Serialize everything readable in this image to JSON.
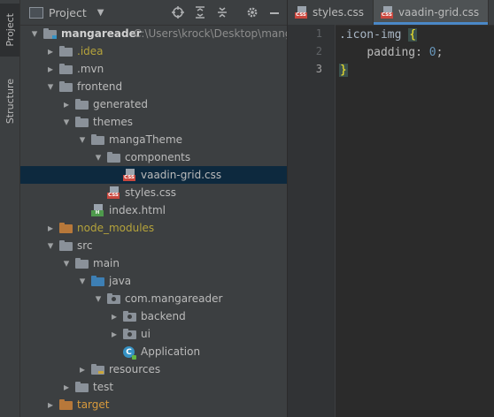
{
  "sidebar_tabs": {
    "project": "Project",
    "structure": "Structure"
  },
  "panel": {
    "title": "Project"
  },
  "tree": [
    {
      "label": "mangareader",
      "path": "C:\\Users\\krock\\Desktop\\mangare",
      "depth": 0,
      "arrow": "open",
      "icon": "folder-module",
      "style": "bold"
    },
    {
      "label": ".idea",
      "depth": 1,
      "arrow": "closed",
      "icon": "folder",
      "style": "yellow"
    },
    {
      "label": ".mvn",
      "depth": 1,
      "arrow": "closed",
      "icon": "folder"
    },
    {
      "label": "frontend",
      "depth": 1,
      "arrow": "open",
      "icon": "folder"
    },
    {
      "label": "generated",
      "depth": 2,
      "arrow": "closed",
      "icon": "folder"
    },
    {
      "label": "themes",
      "depth": 2,
      "arrow": "open",
      "icon": "folder"
    },
    {
      "label": "mangaTheme",
      "depth": 3,
      "arrow": "open",
      "icon": "folder"
    },
    {
      "label": "components",
      "depth": 4,
      "arrow": "open",
      "icon": "folder"
    },
    {
      "label": "vaadin-grid.css",
      "depth": 5,
      "arrow": "none",
      "icon": "css",
      "selected": true
    },
    {
      "label": "styles.css",
      "depth": 4,
      "arrow": "none",
      "icon": "css"
    },
    {
      "label": "index.html",
      "depth": 3,
      "arrow": "none",
      "icon": "html"
    },
    {
      "label": "node_modules",
      "depth": 1,
      "arrow": "closed",
      "icon": "folder-orange",
      "style": "yellow"
    },
    {
      "label": "src",
      "depth": 1,
      "arrow": "open",
      "icon": "folder"
    },
    {
      "label": "main",
      "depth": 2,
      "arrow": "open",
      "icon": "folder"
    },
    {
      "label": "java",
      "depth": 3,
      "arrow": "open",
      "icon": "folder-blue"
    },
    {
      "label": "com.mangareader",
      "depth": 4,
      "arrow": "open",
      "icon": "package"
    },
    {
      "label": "backend",
      "depth": 5,
      "arrow": "closed",
      "icon": "package"
    },
    {
      "label": "ui",
      "depth": 5,
      "arrow": "closed",
      "icon": "package"
    },
    {
      "label": "Application",
      "depth": 5,
      "arrow": "none",
      "icon": "app-class"
    },
    {
      "label": "resources",
      "depth": 3,
      "arrow": "closed",
      "icon": "folder-resources"
    },
    {
      "label": "test",
      "depth": 2,
      "arrow": "closed",
      "icon": "folder"
    },
    {
      "label": "target",
      "depth": 1,
      "arrow": "closed",
      "icon": "folder-orange",
      "style": "orange"
    }
  ],
  "editor_tabs": [
    {
      "label": "styles.css",
      "active": false
    },
    {
      "label": "vaadin-grid.css",
      "active": true
    }
  ],
  "code": {
    "line_numbers": [
      "1",
      "2",
      "3"
    ],
    "selector": ".icon-img",
    "open_brace": "{",
    "property": "padding",
    "colon": ":",
    "value": "0",
    "semicolon": ";",
    "close_brace": "}"
  },
  "colors": {
    "accent": "#4a88c7",
    "selection": "#0d293e",
    "folder": "#8a9199",
    "orange_folder": "#b7783a",
    "blue_folder": "#3d7fb4"
  }
}
